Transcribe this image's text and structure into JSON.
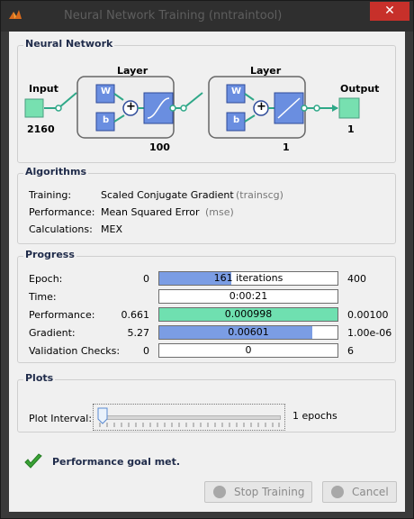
{
  "window": {
    "title": "Neural Network Training (nntraintool)",
    "close_glyph": "✕"
  },
  "network": {
    "group_title": "Neural Network",
    "input_label": "Input",
    "input_size": "2160",
    "layer1_label": "Layer",
    "layer1_size": "100",
    "layer2_label": "Layer",
    "layer2_size": "1",
    "output_label": "Output",
    "output_size": "1",
    "w_label": "W",
    "b_label": "b",
    "plus_glyph": "+"
  },
  "algorithms": {
    "group_title": "Algorithms",
    "rows": [
      {
        "label": "Training:",
        "value": "Scaled Conjugate Gradient",
        "code": "(trainscg)"
      },
      {
        "label": "Performance:",
        "value": "Mean Squared Error",
        "code": "(mse)"
      },
      {
        "label": "Calculations:",
        "value": "MEX",
        "code": ""
      }
    ]
  },
  "progress": {
    "group_title": "Progress",
    "rows": [
      {
        "label": "Epoch:",
        "start": "0",
        "text": "161 iterations",
        "end": "400",
        "fill_fraction": 0.4025,
        "fill_color": "#7b9de4"
      },
      {
        "label": "Time:",
        "start": "",
        "text": "0:00:21",
        "end": "",
        "fill_fraction": 0,
        "fill_color": "#ffffff"
      },
      {
        "label": "Performance:",
        "start": "0.661",
        "text": "0.000998",
        "end": "0.00100",
        "fill_fraction": 1.0,
        "fill_color": "#6fe0b0"
      },
      {
        "label": "Gradient:",
        "start": "5.27",
        "text": "0.00601",
        "end": "1.00e-06",
        "fill_fraction": 0.86,
        "fill_color": "#7b9de4"
      },
      {
        "label": "Validation Checks:",
        "start": "0",
        "text": "0",
        "end": "6",
        "fill_fraction": 0,
        "fill_color": "#ffffff"
      }
    ]
  },
  "plots": {
    "group_title": "Plots",
    "interval_label": "Plot Interval:",
    "interval_value": "1 epochs",
    "slider_fraction": 0
  },
  "status": {
    "message": "Performance goal met.",
    "accent": "#3aa335"
  },
  "buttons": {
    "stop_label": "Stop Training",
    "cancel_label": "Cancel"
  }
}
